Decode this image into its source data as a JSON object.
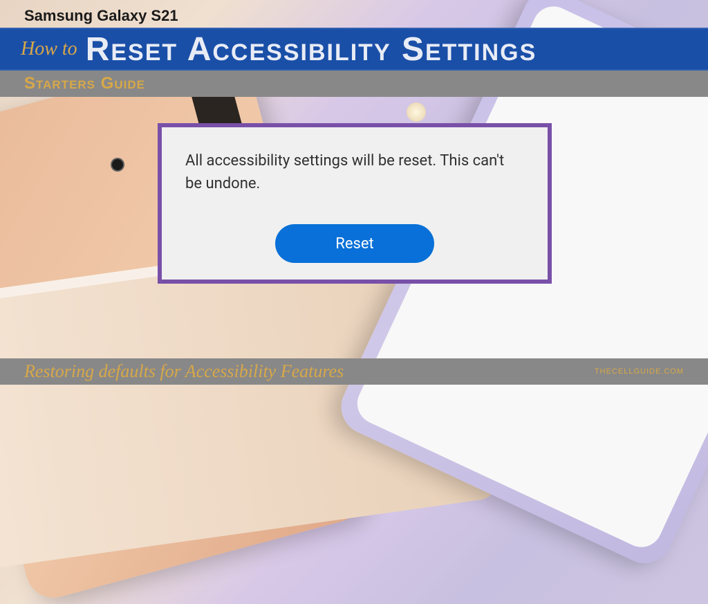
{
  "header": {
    "device_name": "Samsung Galaxy S21",
    "howto_prefix": "How to",
    "main_title": "Reset Accessibility Settings",
    "subtitle": "Starters Guide"
  },
  "dialog": {
    "message": "All accessibility settings will be reset. This can't be undone.",
    "button_label": "Reset"
  },
  "footer": {
    "caption": "Restoring defaults for Accessibility Features",
    "watermark": "THECELLGUIDE.COM"
  }
}
